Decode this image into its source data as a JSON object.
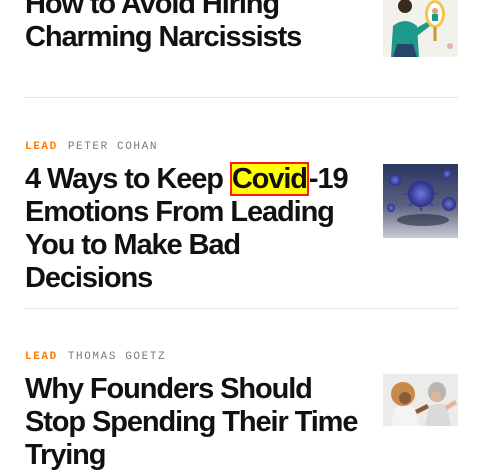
{
  "articles": [
    {
      "headline_line1": "How to Avoid Hiring",
      "headline_line2": "Charming Narcissists",
      "image_icon": "illustration-man-mirror-icon"
    },
    {
      "category": "LEAD",
      "author": "PETER COHAN",
      "headline_before": "4 Ways to Keep ",
      "headline_highlight": "Covid",
      "headline_after": "-19 Emotions From Leading You to Make Bad Decisions",
      "image_icon": "virus-photo-icon"
    },
    {
      "category": "LEAD",
      "author": "THOMAS GOETZ",
      "headline": "Why Founders Should Stop Spending Their Time Trying",
      "image_icon": "people-arguing-photo-icon"
    }
  ],
  "colors": {
    "category": "#ff7a00",
    "author": "#7a7a7a",
    "headline": "#111111",
    "highlight_fill": "#ffff00",
    "highlight_border": "#ff1a1a",
    "divider": "#e6e6e6"
  }
}
